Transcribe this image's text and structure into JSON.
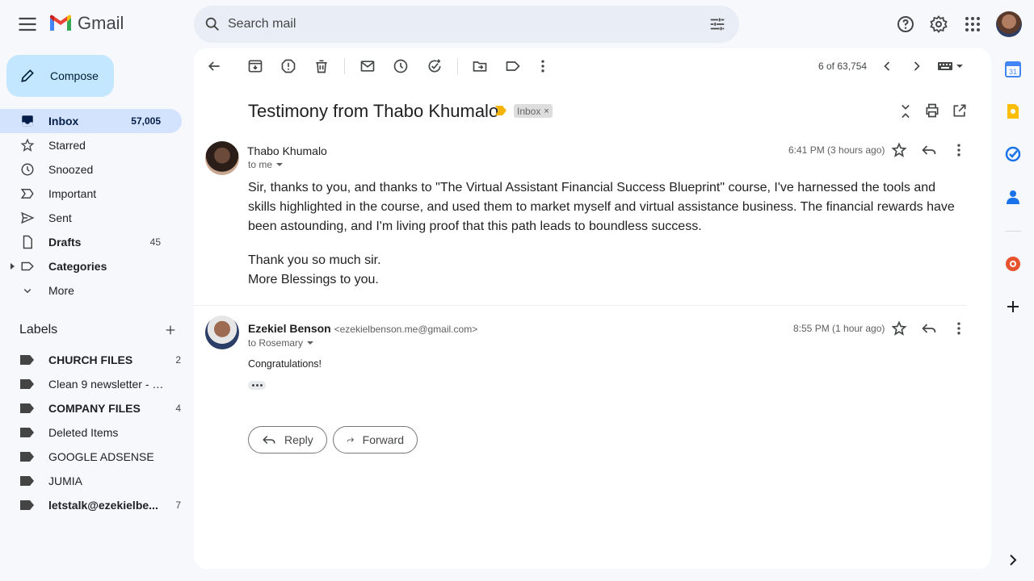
{
  "app": {
    "name": "Gmail"
  },
  "search": {
    "placeholder": "Search mail"
  },
  "compose": {
    "label": "Compose"
  },
  "nav": [
    {
      "label": "Inbox",
      "count": "57,005",
      "icon": "inbox-icon",
      "active": true
    },
    {
      "label": "Starred",
      "count": "",
      "icon": "star-icon"
    },
    {
      "label": "Snoozed",
      "count": "",
      "icon": "clock-icon"
    },
    {
      "label": "Important",
      "count": "",
      "icon": "important-icon"
    },
    {
      "label": "Sent",
      "count": "",
      "icon": "send-icon"
    },
    {
      "label": "Drafts",
      "count": "45",
      "icon": "draft-icon",
      "bold": true
    },
    {
      "label": "Categories",
      "count": "",
      "icon": "label-icon",
      "bold": true
    },
    {
      "label": "More",
      "count": "",
      "icon": "chevron-down-icon"
    }
  ],
  "labels": {
    "title": "Labels",
    "items": [
      {
        "name": "CHURCH FILES",
        "count": "2",
        "bold": true
      },
      {
        "name": "Clean 9 newsletter - NE...",
        "count": ""
      },
      {
        "name": "COMPANY FILES",
        "count": "4",
        "bold": true
      },
      {
        "name": "Deleted Items",
        "count": ""
      },
      {
        "name": "GOOGLE ADSENSE",
        "count": ""
      },
      {
        "name": "JUMIA",
        "count": ""
      },
      {
        "name": "letstalk@ezekielbe...",
        "count": "7",
        "bold": true
      }
    ]
  },
  "pager": {
    "text": "6 of 63,754"
  },
  "thread": {
    "subject": "Testimony from Thabo Khumalo",
    "chip": "Inbox",
    "messages": [
      {
        "sender": "Thabo Khumalo",
        "email": "",
        "to": "to me",
        "time": "6:41 PM (3 hours ago)",
        "body": [
          "Sir, thanks to you, and thanks to \"The Virtual Assistant Financial Success Blueprint\" course, I've harnessed the tools and skills highlighted in the course, and used them to market myself and virtual assistance business. The financial rewards have been astounding, and I'm living proof that this path leads to boundless success.",
          "Thank you so much sir.",
          "More Blessings to you."
        ]
      },
      {
        "sender": "Ezekiel Benson",
        "email": "<ezekielbenson.me@gmail.com>",
        "to": "to Rosemary",
        "time": "8:55 PM (1 hour ago)",
        "body": [
          "Congratulations!"
        ]
      }
    ]
  },
  "actions": {
    "reply": "Reply",
    "forward": "Forward"
  },
  "colors": {
    "accent": "#0b57d0",
    "compose_bg": "#c2e7ff",
    "active_nav": "#d3e3fd"
  }
}
